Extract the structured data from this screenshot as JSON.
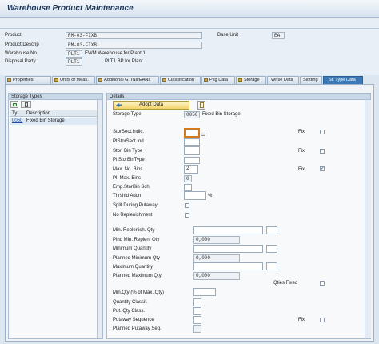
{
  "window": {
    "title": "Warehouse Product Maintenance"
  },
  "header": {
    "product": {
      "label": "Product",
      "value": "RM-03-FIXB"
    },
    "product_descrip": {
      "label": "Product Descrip",
      "value": "RM-03-FIXB"
    },
    "warehouse": {
      "label": "Warehouse No.",
      "value": "PLT1",
      "text": "EWM Warehouse for Plant 1"
    },
    "disposal": {
      "label": "Disposal Party",
      "value": "PLT1",
      "text": "PLT1 BP for Plant"
    },
    "base_unit": {
      "label": "Base Unit",
      "value": "EA"
    }
  },
  "tabs": [
    {
      "label": "Properties",
      "active": false
    },
    {
      "label": "Units of Meas.",
      "active": false
    },
    {
      "label": "Additional GTINs/EANs",
      "active": false
    },
    {
      "label": "Classification",
      "active": false
    },
    {
      "label": "Pkg Data",
      "active": false
    },
    {
      "label": "Storage",
      "active": false
    },
    {
      "label": "Whse Data",
      "active": false
    },
    {
      "label": "Slotting",
      "active": false
    },
    {
      "label": "St. Type Data",
      "active": true
    }
  ],
  "storage_types": {
    "title": "Storage Types",
    "col_ty": "Ty.",
    "col_desc": "Description...",
    "rows": [
      {
        "ty": "0050",
        "desc": "Fixed Bin Storage"
      }
    ]
  },
  "details": {
    "title": "Details",
    "adopt_label": "Adopt Data",
    "storage_type": {
      "label": "Storage Type",
      "value": "0050",
      "text": "Fixed Bin Storage"
    },
    "fix_label": "Fix",
    "qties_fixed_label": "Qties Fixed",
    "rows": [
      {
        "label": "StorSect.Indic.",
        "value": ""
      },
      {
        "label": "PtStorSect.Ind.",
        "value": ""
      },
      {
        "label": "Stor. Bin Type",
        "value": ""
      },
      {
        "label": "Pl.StorBinType",
        "value": ""
      },
      {
        "label": "Max. No. Bins",
        "value": "2"
      },
      {
        "label": "Pl. Max. Bins",
        "value": "0"
      },
      {
        "label": "Emp.StorBin Sch",
        "value": ""
      },
      {
        "label": "Thrshld Addn",
        "value": "",
        "unit": "%"
      },
      {
        "label": "Split During Putaway",
        "value": ""
      },
      {
        "label": "No Replenishment",
        "value": ""
      }
    ],
    "qty_rows": [
      {
        "label": "Min. Replenish. Qty",
        "value": ""
      },
      {
        "label": "Plnd Min. Replen. Qty",
        "value": "0,000"
      },
      {
        "label": "Minimum Quantity",
        "value": ""
      },
      {
        "label": "Planned Minimum Qty",
        "value": "0,000"
      },
      {
        "label": "Maximum Quantity",
        "value": ""
      },
      {
        "label": "Planned Maximum Qty",
        "value": "0,000"
      }
    ],
    "bottom_rows": [
      {
        "label": "Min.Qty (% of Max. Qty)",
        "value": ""
      },
      {
        "label": "Quantity Classif.",
        "value": ""
      },
      {
        "label": "Put. Qty Class.",
        "value": ""
      },
      {
        "label": "Putaway Sequence",
        "value": ""
      },
      {
        "label": "Planned Putaway Seq.",
        "value": ""
      }
    ],
    "fix_checked": [
      false,
      false,
      true
    ]
  },
  "colors": {
    "accent": "#3a78b6",
    "required": "#d47a1e",
    "button": "#f2d26a"
  }
}
